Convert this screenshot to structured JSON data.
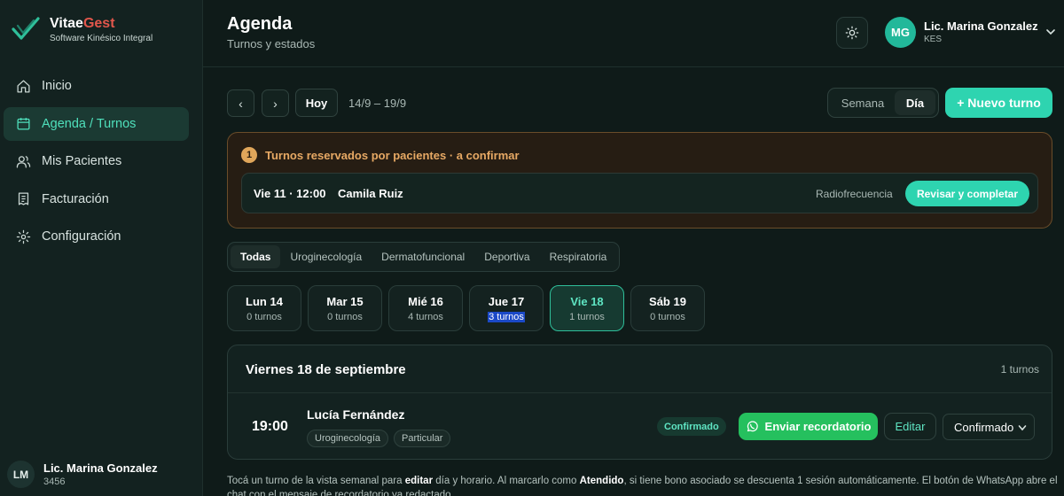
{
  "brand": {
    "name_part1": "Vitae",
    "name_part2": "Gest",
    "subtitle": "Software Kinésico Integral",
    "accent_color": "#e2574c",
    "logo_icon": "checkmark-logo-icon"
  },
  "sidebar": {
    "items": [
      {
        "label": "Inicio",
        "icon": "home-icon",
        "active": false
      },
      {
        "label": "Agenda / Turnos",
        "icon": "calendar-icon",
        "active": true
      },
      {
        "label": "Mis Pacientes",
        "icon": "users-icon",
        "active": false
      },
      {
        "label": "Facturación",
        "icon": "receipt-icon",
        "active": false
      },
      {
        "label": "Configuración",
        "icon": "settings-icon",
        "active": false
      }
    ],
    "user": {
      "initials": "LM",
      "name": "Lic. Marina Gonzalez",
      "id": "3456"
    }
  },
  "header": {
    "title": "Agenda",
    "subtitle": "Turnos y estados",
    "user": {
      "initials": "MG",
      "name": "Lic. Marina Gonzalez",
      "role": "KES"
    }
  },
  "toolbar": {
    "prev": "‹",
    "next": "›",
    "today": "Hoy",
    "range": "14/9 – 19/9",
    "view_week": "Semana",
    "view_day": "Día",
    "selected_view": "Día",
    "new_appointment": "+ Nuevo turno",
    "accent_color": "#2ed4b0"
  },
  "pending": {
    "count": "1",
    "title": "Turnos reservados por pacientes · a confirmar",
    "items": [
      {
        "when": "Vie 11 · 12:00",
        "patient": "Camila Ruiz",
        "service": "Radiofrecuencia",
        "action": "Revisar y completar"
      }
    ]
  },
  "filters": {
    "selected": "Todas",
    "items": [
      "Todas",
      "Uroginecología",
      "Dermatofuncional",
      "Deportiva",
      "Respiratoria"
    ]
  },
  "days": [
    {
      "label": "Lun 14",
      "count": "0 turnos",
      "active": false,
      "highlight": false
    },
    {
      "label": "Mar 15",
      "count": "0 turnos",
      "active": false,
      "highlight": false
    },
    {
      "label": "Mié 16",
      "count": "4 turnos",
      "active": false,
      "highlight": false
    },
    {
      "label": "Jue 17",
      "count": "3 turnos",
      "active": false,
      "highlight": true
    },
    {
      "label": "Vie 18",
      "count": "1 turnos",
      "active": true,
      "highlight": false
    },
    {
      "label": "Sáb 19",
      "count": "0 turnos",
      "active": false,
      "highlight": false
    }
  ],
  "day_panel": {
    "title": "Viernes 18 de septiembre",
    "count": "1 turnos",
    "appointments": [
      {
        "time": "19:00",
        "patient": "Lucía Fernández",
        "tags": [
          "Uroginecología",
          "Particular"
        ],
        "status": "Confirmado",
        "whatsapp": "Enviar recordatorio",
        "edit": "Editar",
        "status_select": "Confirmado"
      }
    ]
  },
  "footnote": {
    "part1": "Tocá un turno de la vista semanal para ",
    "bold1": "editar",
    "part2": " día y horario. Al marcarlo como ",
    "bold2": "Atendido",
    "part3": ", si tiene bono asociado se descuenta 1 sesión automáticamente. El botón de WhatsApp abre el chat con el mensaje de recordatorio ya redactado."
  }
}
